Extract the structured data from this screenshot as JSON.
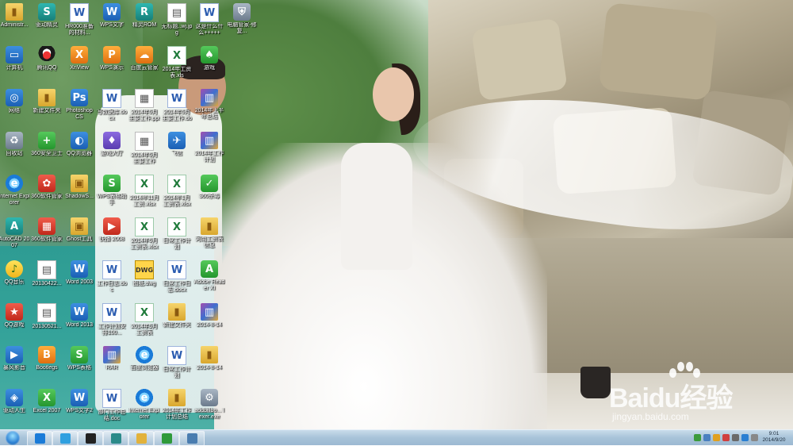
{
  "desktop": {
    "icons": [
      {
        "label": "Administr...",
        "icon": "folder-user-icon"
      },
      {
        "label": "驱动精灵",
        "icon": "driver-icon"
      },
      {
        "label": "HR000准备的材料...",
        "icon": "word-doc-icon"
      },
      {
        "label": "WPS文字",
        "icon": "wps-writer-icon"
      },
      {
        "label": "精灵ROM",
        "icon": "rom-icon"
      },
      {
        "label": "无标题..wj.jpg",
        "icon": "image-file-icon"
      },
      {
        "label": "这是什么什么+++++",
        "icon": "word-doc-icon"
      },
      {
        "label": "电脑管家-修复...",
        "icon": "security-icon"
      },
      {
        "label": "计算机",
        "icon": "computer-icon"
      },
      {
        "label": "腾讯QQ",
        "icon": "qq-icon"
      },
      {
        "label": "XnView",
        "icon": "xnview-icon"
      },
      {
        "label": "WPS演示",
        "icon": "wps-presentation-icon"
      },
      {
        "label": "百度云管家",
        "icon": "baidu-cloud-icon"
      },
      {
        "label": "2014年工资表.xls",
        "icon": "excel-file-icon"
      },
      {
        "label": "游戏",
        "icon": "game-icon"
      },
      {
        "label": "网络",
        "icon": "network-icon"
      },
      {
        "label": "新建文件夹",
        "icon": "folder-icon"
      },
      {
        "label": "Photoshop CS",
        "icon": "photoshop-icon"
      },
      {
        "label": "写数据库.docx",
        "icon": "word-doc-icon"
      },
      {
        "label": "2014年5月主要工作.pptx",
        "icon": "presentation-file-icon"
      },
      {
        "label": "2014年5月主要工作.docx",
        "icon": "word-doc-icon"
      },
      {
        "label": "2014年上半年总结",
        "icon": "rar-file-icon"
      },
      {
        "label": "回收站",
        "icon": "recycle-bin-icon"
      },
      {
        "label": "360安全卫士",
        "icon": "360-safe-icon"
      },
      {
        "label": "QQ浏览器",
        "icon": "qq-browser-icon"
      },
      {
        "label": "游戏大厅",
        "icon": "game-hall-icon"
      },
      {
        "label": "2014年5月主要工作",
        "icon": "presentation-file-icon"
      },
      {
        "label": "飞信",
        "icon": "fetion-icon"
      },
      {
        "label": "2014年工作计划",
        "icon": "rar-file-icon"
      },
      {
        "label": "Internet Explorer",
        "icon": "ie-icon"
      },
      {
        "label": "360软件管家",
        "icon": "360-soft-icon"
      },
      {
        "label": "ShadowS...",
        "icon": "shadow-icon"
      },
      {
        "label": "WPS表格助手",
        "icon": "wps-spreadsheet-icon"
      },
      {
        "label": "2014年11月工资.xlsx",
        "icon": "excel-file-icon"
      },
      {
        "label": "2014年1月工资表.xlsx",
        "icon": "excel-file-icon"
      },
      {
        "label": "360杀毒",
        "icon": "360-av-icon"
      },
      {
        "label": "AutoCAD 2007",
        "icon": "autocad-icon"
      },
      {
        "label": "360软件管家",
        "icon": "360-box-icon"
      },
      {
        "label": "Ghost工具",
        "icon": "ghost-icon"
      },
      {
        "label": "快播 2008",
        "icon": "player-icon"
      },
      {
        "label": "2014年5月工资表.xlsx",
        "icon": "excel-file-icon"
      },
      {
        "label": "日常工作计划",
        "icon": "excel-file-icon"
      },
      {
        "label": "河南工资表信息",
        "icon": "folder-icon"
      },
      {
        "label": "QQ音乐",
        "icon": "qq-music-icon"
      },
      {
        "label": "20130422...",
        "icon": "image-file-icon"
      },
      {
        "label": "Word 2003",
        "icon": "word-2003-icon"
      },
      {
        "label": "工作日志.doc",
        "icon": "word-doc-icon"
      },
      {
        "label": "图纸.dwg",
        "icon": "dwg-file-icon"
      },
      {
        "label": "日常工作日志.docx",
        "icon": "word-doc-icon"
      },
      {
        "label": "Adobe Reader XI",
        "icon": "adobe-reader-icon"
      },
      {
        "label": "QQ游戏",
        "icon": "qq-game-icon"
      },
      {
        "label": "20130521...",
        "icon": "image-file-icon"
      },
      {
        "label": "Word 2013",
        "icon": "word-2013-icon"
      },
      {
        "label": "工作计划安排100...",
        "icon": "word-doc-icon"
      },
      {
        "label": "2014年5月工资表",
        "icon": "excel-file-icon"
      },
      {
        "label": "新建文件夹",
        "icon": "folder-icon"
      },
      {
        "label": "2014-8-14",
        "icon": "rar-file-icon"
      },
      {
        "label": "暴风影音",
        "icon": "storm-player-icon"
      },
      {
        "label": "Bootlegs",
        "icon": "bootlegs-icon"
      },
      {
        "label": "WPS表格",
        "icon": "wps-sheet-icon"
      },
      {
        "label": "RAR",
        "icon": "rar-file-icon"
      },
      {
        "label": "百度浏览器",
        "icon": "browser-icon"
      },
      {
        "label": "日常工作计划",
        "icon": "word-doc-icon"
      },
      {
        "label": "2014-8-14",
        "icon": "folder-icon"
      },
      {
        "label": "驱动人生",
        "icon": "driver-life-icon"
      },
      {
        "label": "Excel 2007",
        "icon": "excel-app-icon"
      },
      {
        "label": "WPS文字2",
        "icon": "wps-writer-icon"
      },
      {
        "label": "部门工作总结.doc",
        "icon": "word-doc-icon"
      },
      {
        "label": "Internet Explorer",
        "icon": "ie-icon"
      },
      {
        "label": "2014年工作计划总结",
        "icon": "folder-icon"
      },
      {
        "label": "addbillbo... lexer.exe",
        "icon": "exe-file-icon"
      }
    ]
  },
  "taskbar": {
    "clock_time": "9:01",
    "clock_date": "2014/9/20",
    "pinned": [
      {
        "name": "ie-icon",
        "color": "#1a7bd8"
      },
      {
        "name": "browser-icon",
        "color": "#2fa0e0"
      },
      {
        "name": "media-player-icon",
        "color": "#222222"
      },
      {
        "name": "autocad-icon",
        "color": "#2b8a8a"
      },
      {
        "name": "folder-icon",
        "color": "#e2b23c"
      },
      {
        "name": "wps-sheet-icon",
        "color": "#2f9a3a"
      },
      {
        "name": "network-icon",
        "color": "#4a7db0"
      }
    ]
  },
  "watermark": {
    "brand": "Baidu经验",
    "url": "jingyan.baidu.com"
  }
}
